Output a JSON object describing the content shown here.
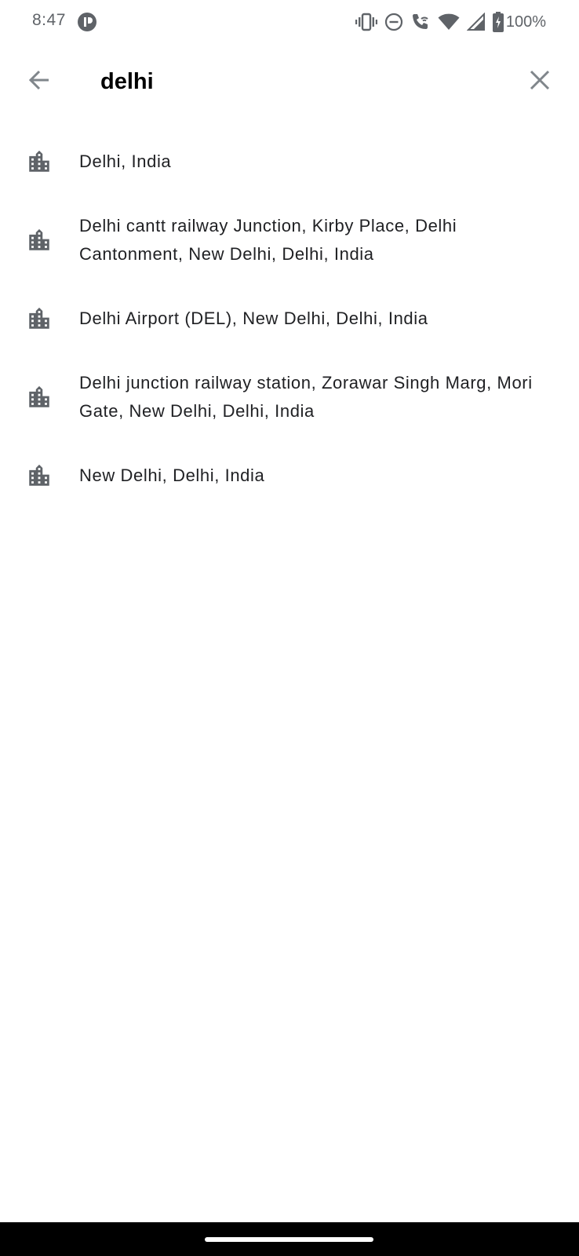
{
  "status_bar": {
    "time": "8:47",
    "battery": "100%",
    "icons": [
      "app-notification-icon",
      "vibrate-icon",
      "do-not-disturb-icon",
      "wifi-calling-icon",
      "wifi-icon",
      "signal-icon",
      "battery-charging-icon"
    ]
  },
  "search": {
    "query": "delhi",
    "back_icon": "arrow-back-icon",
    "clear_icon": "close-icon"
  },
  "results": [
    {
      "label": "Delhi, India",
      "icon": "city-icon"
    },
    {
      "label": "Delhi cantt railway Junction, Kirby Place, Delhi Cantonment, New Delhi, Delhi, India",
      "icon": "city-icon"
    },
    {
      "label": "Delhi Airport (DEL), New Delhi, Delhi, India",
      "icon": "city-icon"
    },
    {
      "label": "Delhi junction railway station, Zorawar Singh Marg, Mori Gate, New Delhi, Delhi, India",
      "icon": "city-icon"
    },
    {
      "label": "New Delhi, Delhi, India",
      "icon": "city-icon"
    }
  ],
  "colors": {
    "text_primary": "#202124",
    "icon_gray": "#5f6368",
    "query_text": "#000000",
    "nav_bar": "#000000"
  }
}
